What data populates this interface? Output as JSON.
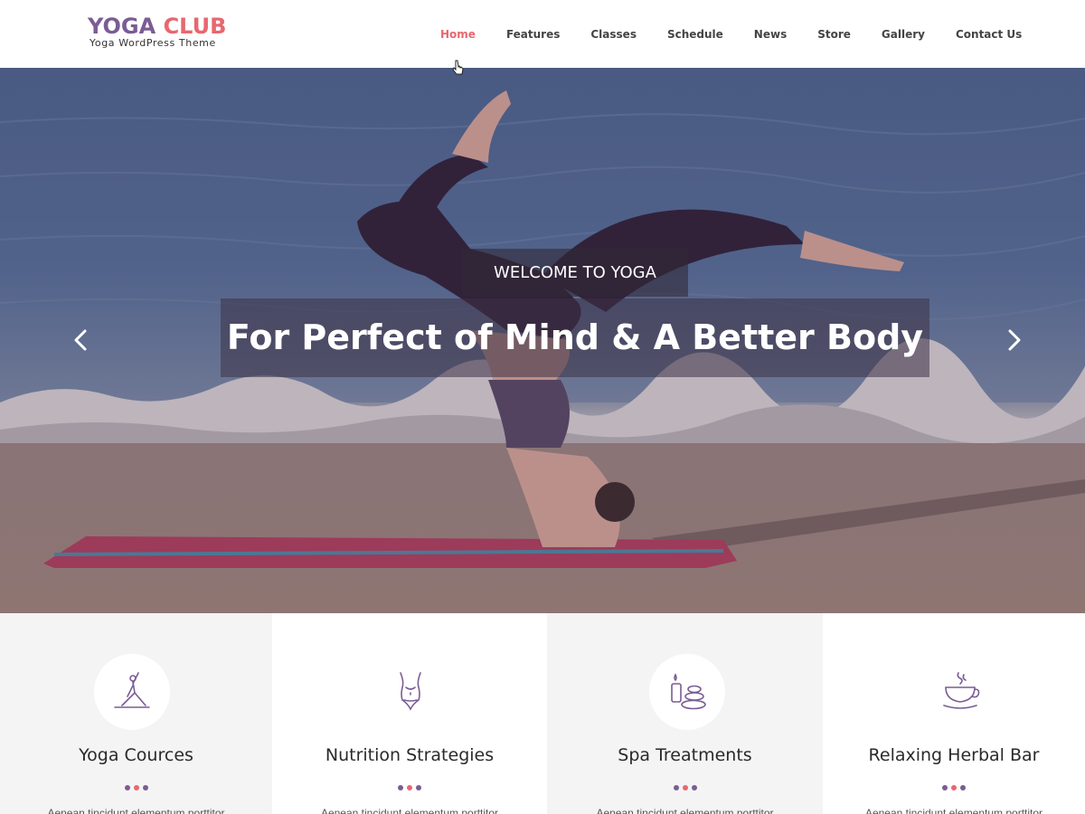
{
  "logo": {
    "word1": "YOGA",
    "word2": "CLUB",
    "subtitle": "Yoga WordPress Theme"
  },
  "nav": {
    "items": [
      "Home",
      "Features",
      "Classes",
      "Schedule",
      "News",
      "Store",
      "Gallery",
      "Contact Us"
    ],
    "active": "Home"
  },
  "hero": {
    "kicker": "WELCOME TO YOGA",
    "headline": "For Perfect of Mind & A Better Body",
    "prev_icon": "chevron-left-icon",
    "next_icon": "chevron-right-icon"
  },
  "features": [
    {
      "title": "Yoga Cources",
      "icon": "yoga-pose-icon",
      "text": "Aenean tincidunt elementum porttitor"
    },
    {
      "title": "Nutrition Strategies",
      "icon": "body-figure-icon",
      "text": "Aenean tincidunt elementum porttitor"
    },
    {
      "title": "Spa Treatments",
      "icon": "spa-stones-icon",
      "text": "Aenean tincidunt elementum porttitor"
    },
    {
      "title": "Relaxing Herbal Bar",
      "icon": "tea-cup-icon",
      "text": "Aenean tincidunt elementum porttitor"
    }
  ],
  "colors": {
    "brand_purple": "#7b5c94",
    "brand_pink": "#e8676f"
  }
}
